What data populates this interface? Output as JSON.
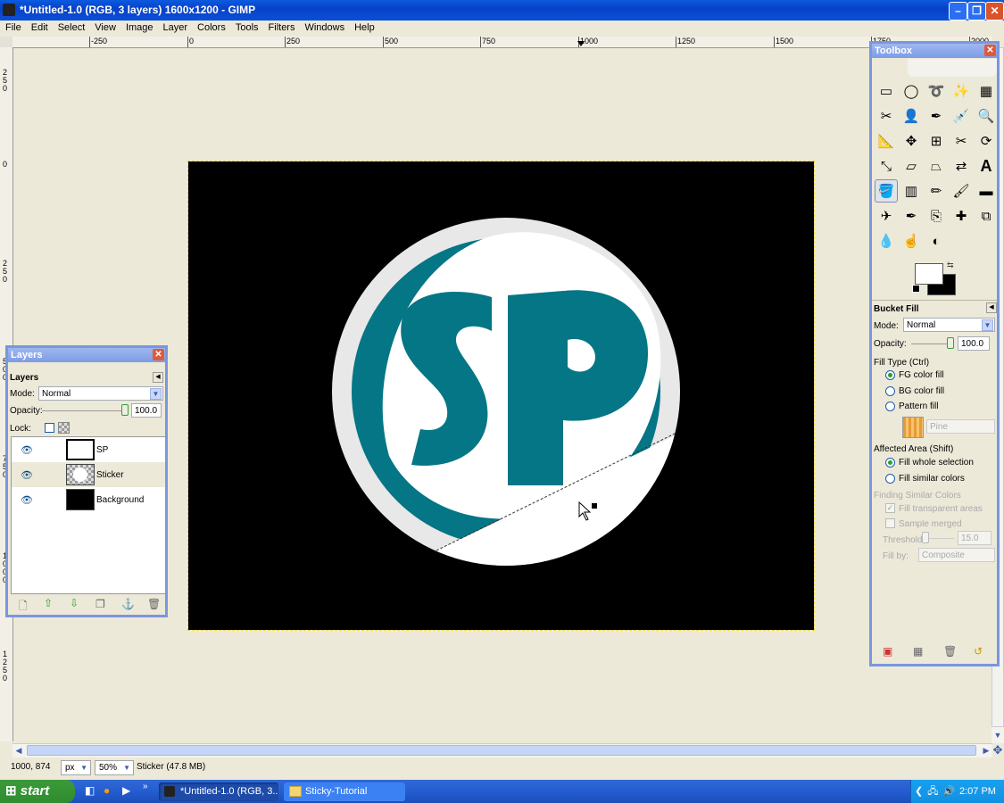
{
  "window": {
    "title": "*Untitled-1.0 (RGB, 3 layers) 1600x1200 - GIMP"
  },
  "menu": [
    "File",
    "Edit",
    "Select",
    "View",
    "Image",
    "Layer",
    "Colors",
    "Tools",
    "Filters",
    "Windows",
    "Help"
  ],
  "ruler": {
    "h_labels": [
      "-250",
      "0",
      "250",
      "500",
      "750",
      "1000",
      "1250",
      "1500",
      "1750",
      "2000"
    ],
    "v_labels": [
      "250",
      "0",
      "250",
      "500",
      "750",
      "1000",
      "1250"
    ]
  },
  "layers_dialog": {
    "title": "Layers",
    "tab_label": "Layers",
    "mode_label": "Mode:",
    "mode_value": "Normal",
    "opacity_label": "Opacity:",
    "opacity_value": "100.0",
    "lock_label": "Lock:",
    "layers": [
      {
        "name": "SP"
      },
      {
        "name": "Sticker"
      },
      {
        "name": "Background"
      }
    ]
  },
  "toolbox": {
    "title": "Toolbox",
    "tools": [
      [
        "rect-select-icon",
        "ellipse-select-icon",
        "free-select-icon",
        "fuzzy-select-icon",
        "color-select-icon"
      ],
      [
        "scissors-icon",
        "foreground-select-icon",
        "paths-icon",
        "color-picker-icon",
        "zoom-icon"
      ],
      [
        "measure-icon",
        "move-icon",
        "align-icon",
        "crop-icon",
        "rotate-icon"
      ],
      [
        "scale-icon",
        "shear-icon",
        "perspective-icon",
        "flip-icon",
        "text-icon"
      ],
      [
        "bucket-fill-icon",
        "blend-icon",
        "pencil-icon",
        "paintbrush-icon",
        "eraser-icon"
      ],
      [
        "airbrush-icon",
        "ink-icon",
        "clone-icon",
        "heal-icon",
        "perspective-clone-icon"
      ],
      [
        "blur-icon",
        "smudge-icon",
        "dodge-burn-icon"
      ]
    ],
    "tool_options": {
      "title": "Bucket Fill",
      "mode_label": "Mode:",
      "mode_value": "Normal",
      "opacity_label": "Opacity:",
      "opacity_value": "100.0",
      "fill_type_label": "Fill Type  (Ctrl)",
      "fill_types": [
        "FG color fill",
        "BG color fill",
        "Pattern fill"
      ],
      "fill_type_selected": 0,
      "pattern_name": "Pine",
      "affected_area_label": "Affected Area  (Shift)",
      "affected_options": [
        "Fill whole selection",
        "Fill similar colors"
      ],
      "affected_selected": 0,
      "finding_label": "Finding Similar Colors",
      "fill_transparent": "Fill transparent areas",
      "sample_merged": "Sample merged",
      "threshold_label": "Threshold:",
      "threshold_value": "15.0",
      "fill_by_label": "Fill by:",
      "fill_by_value": "Composite"
    }
  },
  "canvas": {
    "logo_text": "SP",
    "colors": {
      "teal": "#047685",
      "ring": "#e8e8e8"
    }
  },
  "status": {
    "coords": "1000, 874",
    "unit": "px",
    "zoom": "50%",
    "message": "Sticker (47.8 MB)"
  },
  "taskbar": {
    "start": "start",
    "items": [
      "*Untitled-1.0 (RGB, 3...",
      "Sticky-Tutorial"
    ],
    "clock": "2:07 PM"
  }
}
